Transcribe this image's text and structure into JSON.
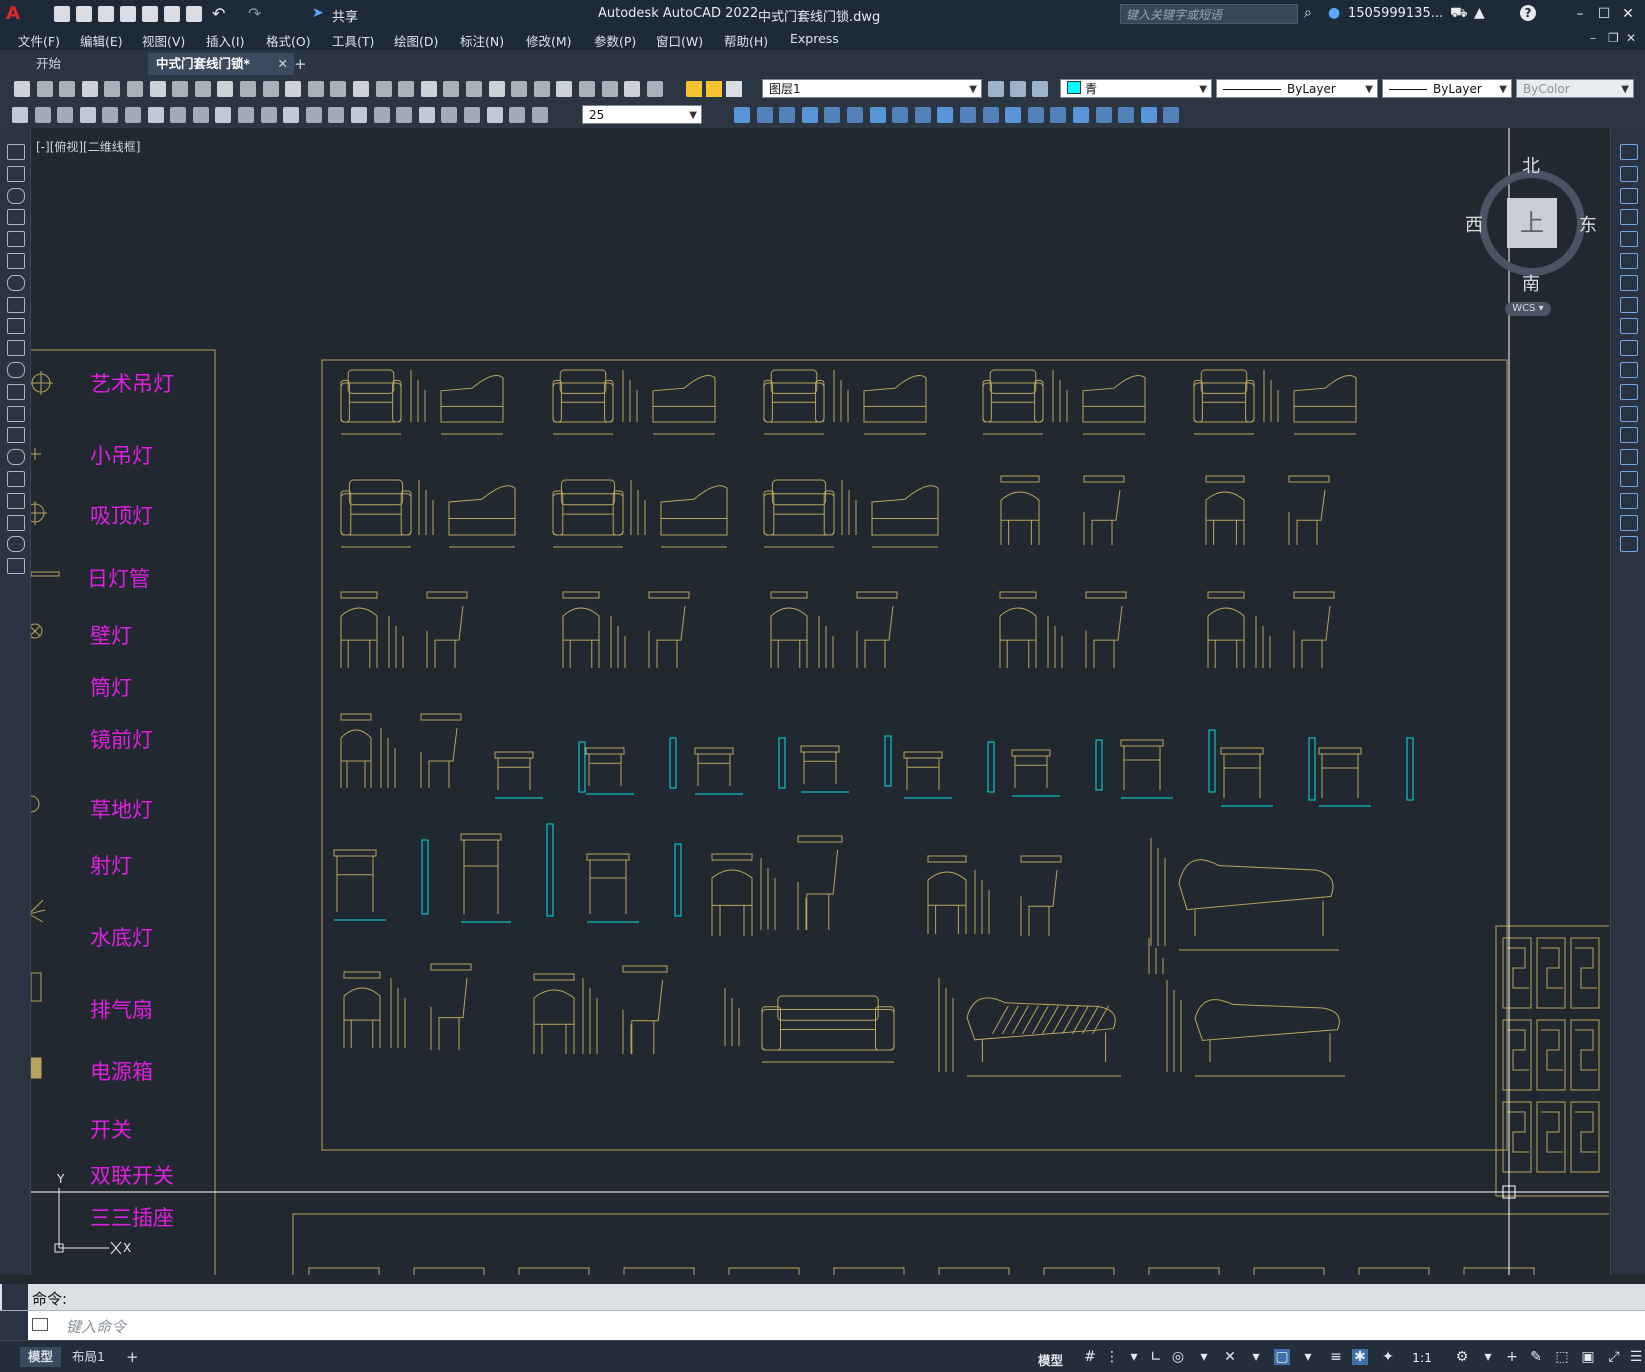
{
  "app": {
    "title": "Autodesk AutoCAD 2022",
    "document": "中式门套线门锁.dwg",
    "share_label": "共享",
    "search_placeholder": "键入关键字或短语",
    "user": "1505999135...",
    "help": "?"
  },
  "menu": [
    "文件(F)",
    "编辑(E)",
    "视图(V)",
    "插入(I)",
    "格式(O)",
    "工具(T)",
    "绘图(D)",
    "标注(N)",
    "修改(M)",
    "参数(P)",
    "窗口(W)",
    "帮助(H)",
    "Express"
  ],
  "tabs": {
    "start": "开始",
    "active": "中式门套线门锁*",
    "add": "+"
  },
  "properties": {
    "layer": "图层1",
    "color": "青",
    "linetype": "ByLayer",
    "lineweight": "ByLayer",
    "plotstyle": "ByColor",
    "dimscale": "25",
    "cyan_hex": "#00ffff"
  },
  "viewport": {
    "label": "[-][俯视][二维线框]"
  },
  "viewcube": {
    "north": "北",
    "south": "南",
    "east": "东",
    "west": "西",
    "top": "上",
    "wcs": "WCS"
  },
  "legend_items": [
    "艺术吊灯",
    "小吊灯",
    "吸顶灯",
    "日灯管",
    "壁灯",
    "筒灯",
    "镜前灯",
    "草地灯",
    "射灯",
    "水底灯",
    "排气扇",
    "电源箱",
    "开关",
    "双联开关",
    "三三插座"
  ],
  "ucs": {
    "y": "Y",
    "x": "X"
  },
  "command": {
    "history_label": "命令:",
    "placeholder": "键入命令"
  },
  "status": {
    "model_tab": "模型",
    "layout_tab": "布局1",
    "add": "+",
    "model_label": "模型",
    "scale": "1:1"
  },
  "colors": {
    "drawing": "#b9a45d",
    "legend": "#e020e0",
    "background": "#212830"
  }
}
